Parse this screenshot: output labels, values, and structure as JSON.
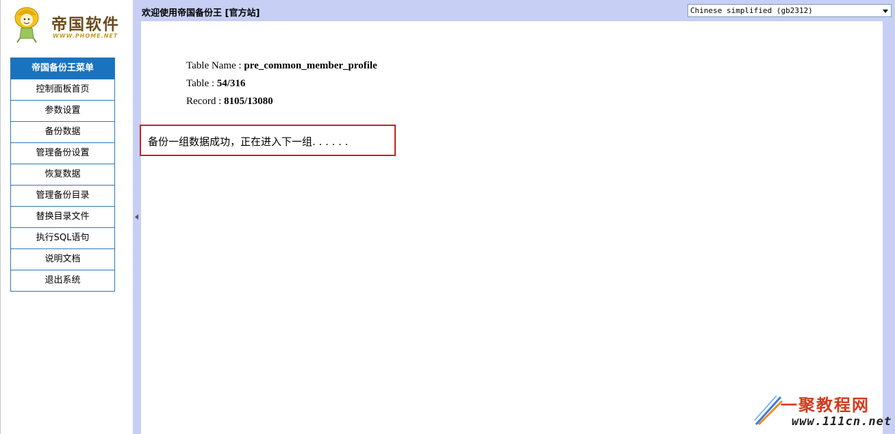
{
  "logo": {
    "name": "帝国软件",
    "url": "WWW.PHOME.NET"
  },
  "sidebar": {
    "menu_title": "帝国备份王菜单",
    "items": [
      {
        "label": "控制面板首页"
      },
      {
        "label": "参数设置"
      },
      {
        "label": "备份数据"
      },
      {
        "label": "管理备份设置"
      },
      {
        "label": "恢复数据"
      },
      {
        "label": "管理备份目录"
      },
      {
        "label": "替换目录文件"
      },
      {
        "label": "执行SQL语句"
      },
      {
        "label": "说明文档"
      },
      {
        "label": "退出系统"
      }
    ]
  },
  "header": {
    "title": "欢迎使用帝国备份王 [官方站]",
    "language_select": "Chinese simplified (gb2312)"
  },
  "main": {
    "table_name_label": "Table Name : ",
    "table_name_value": "pre_common_member_profile",
    "table_label": "Table : ",
    "table_value": "54/316",
    "record_label": "Record : ",
    "record_value": "8105/13080",
    "status_message": "备份一组数据成功，正在进入下一组. . . . . ."
  },
  "watermark": {
    "main": "一聚教程网",
    "sub": "www.111cn.net"
  },
  "colors": {
    "menu_header": "#1a73be",
    "frame_bg": "#c7cff5",
    "highlight_border": "#cc1f1f"
  }
}
